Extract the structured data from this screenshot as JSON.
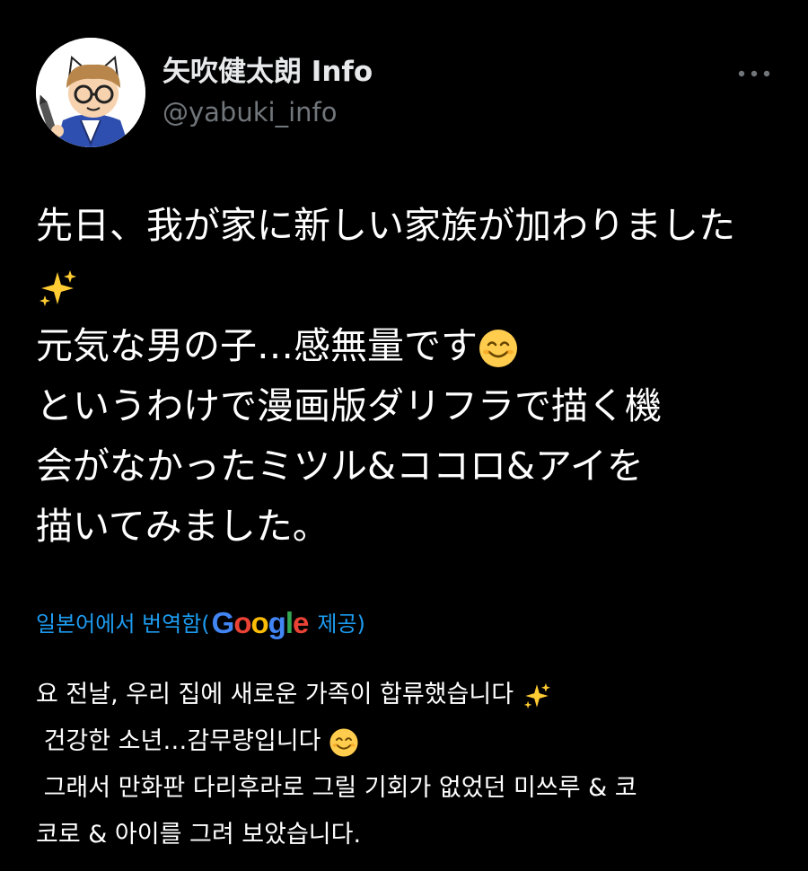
{
  "author": {
    "display_name": "矢吹健太朗 Info",
    "handle": "@yabuki_info"
  },
  "more_button": {
    "icon": "more-horizontal-icon"
  },
  "tweet": {
    "lines": [
      "先日、我が家に新しい家族が加わりました",
      "元気な男の子…感無量です",
      "というわけで漫画版ダリフラで描く機",
      "会がなかったミツル&ココロ&アイを",
      "描いてみました。"
    ]
  },
  "translation": {
    "prefix": "일본어에서 번역함(",
    "google": [
      "G",
      "o",
      "o",
      "g",
      "l",
      "e"
    ],
    "google_colors": [
      "#4285F4",
      "#EA4335",
      "#FBBC05",
      "#4285F4",
      "#34A853",
      "#EA4335"
    ],
    "suffix": "제공)",
    "lines": [
      "요 전날, 우리 집에 새로운 가족이 합류했습니다",
      " 건강한 소년…감무량입니다",
      " 그래서 만화판 다리후라로 그릴 기회가 없었던 미쓰루 & 코",
      "코로 & 아이를 그려 보았습니다."
    ]
  },
  "colors": {
    "background": "#000000",
    "text": "#ffffff",
    "secondary": "#71767b",
    "link": "#1d9bf0"
  },
  "icons": [
    "sparkles-icon",
    "smiling-face-icon"
  ]
}
